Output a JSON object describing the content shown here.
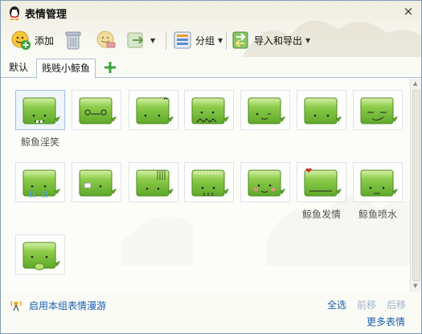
{
  "window": {
    "title": "表情管理",
    "close": "×"
  },
  "toolbar": {
    "add_label": "添加",
    "group_label": "分组",
    "import_export_label": "导入和导出"
  },
  "tabs": [
    {
      "label": "默认"
    },
    {
      "label": "贱贱小鲸鱼"
    }
  ],
  "emoticons": [
    {
      "caption": "鲸鱼淫笑"
    },
    {
      "caption": ""
    },
    {
      "caption": ""
    },
    {
      "caption": ""
    },
    {
      "caption": ""
    },
    {
      "caption": ""
    },
    {
      "caption": ""
    },
    {
      "caption": ""
    },
    {
      "caption": ""
    },
    {
      "caption": ""
    },
    {
      "caption": ""
    },
    {
      "caption": ""
    },
    {
      "caption": "鲸鱼发情"
    },
    {
      "caption": "鲸鱼喷水"
    },
    {
      "caption": ""
    }
  ],
  "footer": {
    "roam_label": "启用本组表情漫游",
    "select_all": "全选",
    "move_forward": "前移",
    "move_back": "后移",
    "more": "更多表情"
  },
  "colors": {
    "link": "#1a5fb4",
    "disabled_link": "#9fb3c9",
    "whale_green": "#7ec43a",
    "tab_border": "#a9bcd5"
  }
}
